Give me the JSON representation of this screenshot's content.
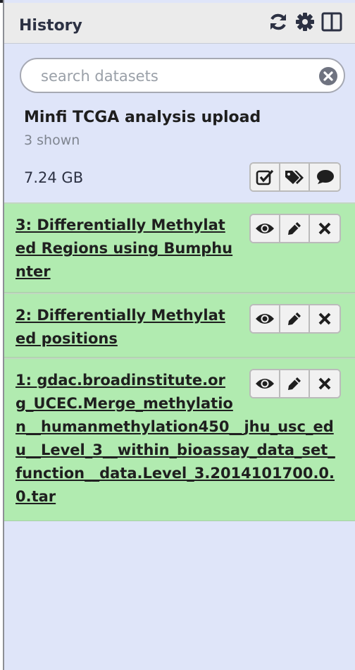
{
  "header": {
    "title": "History",
    "icons": [
      "refresh-icon",
      "gear-icon",
      "columns-icon"
    ]
  },
  "search": {
    "placeholder": "search datasets",
    "value": ""
  },
  "history": {
    "name": "Minfi TCGA analysis upload",
    "shown": "3 shown",
    "size": "7.24 GB",
    "actions": [
      "checkbox-icon",
      "tags-icon",
      "comment-icon"
    ]
  },
  "datasets": [
    {
      "name": "3: Differentially Methylated Regions using Bumphunter"
    },
    {
      "name": "2: Differentially Methylated positions"
    },
    {
      "name": "1: gdac.broadinstitute.org_UCEC.Merge_methylation__humanmethylation450__jhu_usc_edu__Level_3__within_bioassay_data_set_function__data.Level_3.2014101700.0.0.tar"
    }
  ],
  "colors": {
    "panel_bg": "#dfe5f9",
    "header_bg": "#ebebeb",
    "dataset_ok_bg": "#b1ebb0"
  }
}
